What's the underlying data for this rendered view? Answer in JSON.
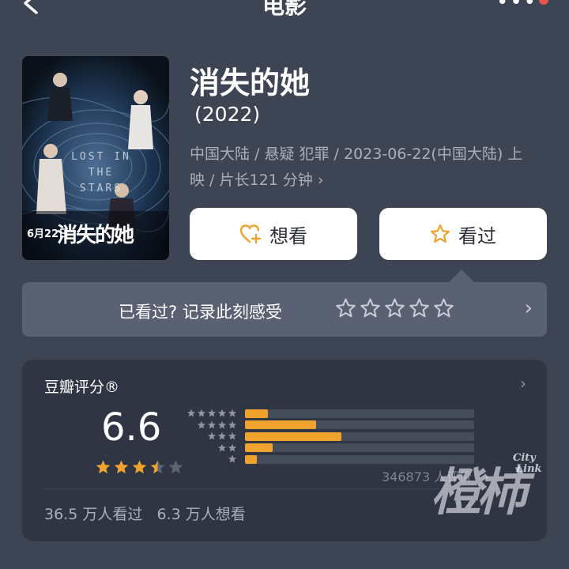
{
  "nav": {
    "back_icon": "chevron-left-icon",
    "title": "电影",
    "more_icon": "more-dots-icon"
  },
  "movie": {
    "poster": {
      "english_title": "LOST IN THE STARS",
      "date": "6月22日",
      "chinese_title": "消失的她"
    },
    "title": "消失的她",
    "year": "(2022)",
    "meta_line1": "中国大陆 / 悬疑 犯罪 / 2023-06-22(中国大陆) 上",
    "meta_line2": "映 / 片长121 分钟",
    "meta_chevron": "›"
  },
  "actions": {
    "want_label": "想看",
    "want_icon": "heart-plus-icon",
    "seen_label": "看过",
    "seen_icon": "star-outline-icon"
  },
  "rating_prompt": {
    "text": "已看过? 记录此刻感受",
    "star_count": 5,
    "arrow": "›"
  },
  "douban": {
    "label": "豆瓣评分®",
    "arrow": "›",
    "score": "6.6",
    "stars": [
      1,
      1,
      1,
      0.5,
      0
    ],
    "distribution": [
      {
        "stars": 5,
        "fraction": 0.1
      },
      {
        "stars": 4,
        "fraction": 0.31
      },
      {
        "stars": 3,
        "fraction": 0.42
      },
      {
        "stars": 2,
        "fraction": 0.12
      },
      {
        "stars": 1,
        "fraction": 0.05
      }
    ],
    "count": "346873 人评价",
    "seen_count": "36.5 万人看过",
    "want_count": "6.3 万人想看"
  },
  "watermark": {
    "main": "橙柿",
    "city": "City",
    "link": "Link"
  },
  "colors": {
    "background": "#3d4453",
    "card": "#2f3542",
    "prompt_bar": "#596172",
    "accent_orange": "#f0a22e"
  }
}
